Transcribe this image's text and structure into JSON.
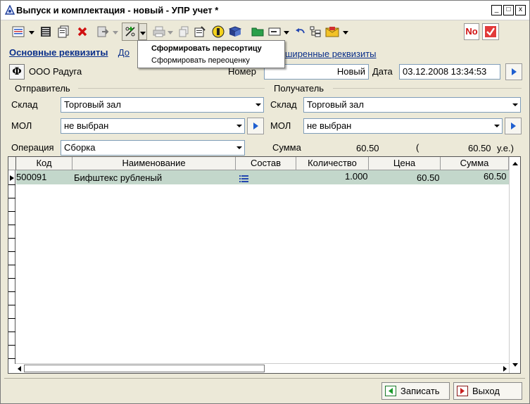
{
  "window": {
    "title": "Выпуск и комплектация  - новый - УПР учет *",
    "controls": {
      "minimize": "_",
      "maximize": "□",
      "close": "x"
    }
  },
  "toolbar": {
    "badge_no": "No",
    "icons": [
      "list-icon",
      "report-icon",
      "copy-icon",
      "delete-icon",
      "export-icon",
      "percent-icon",
      "print-icon",
      "copy-doc-icon",
      "properties-icon",
      "info-icon",
      "book-icon",
      "folder-icon",
      "card-icon",
      "undo-icon",
      "structure-icon",
      "mail-icon",
      "no-icon",
      "check-icon"
    ]
  },
  "popup_menu": {
    "items": [
      "Сформировать пересортицу",
      "Сформировать переоценку"
    ]
  },
  "tabs_links": {
    "main": "Основные реквизиты",
    "additional_partial": "До",
    "extended_partial": "ширенные реквизиты"
  },
  "header": {
    "org_button": "Ф",
    "org_name": "ООО Радуга",
    "number_label": "Номер",
    "number_status": "Новый",
    "date_label": "Дата",
    "date_value": "03.12.2008 13:34:53"
  },
  "sender": {
    "group_label": "Отправитель",
    "warehouse_label": "Склад",
    "warehouse_value": "Торговый зал",
    "mol_label": "МОЛ",
    "mol_value": "не выбран"
  },
  "receiver": {
    "group_label": "Получатель",
    "warehouse_label": "Склад",
    "warehouse_value": "Торговый зал",
    "mol_label": "МОЛ",
    "mol_value": "не выбран"
  },
  "operation": {
    "label": "Операция",
    "value": "Сборка",
    "sum_label": "Сумма",
    "sum_value": "60.50",
    "paren": "(",
    "sum_ue_value": "60.50",
    "sum_ue_unit": "у.е.)"
  },
  "table": {
    "columns": [
      "Код",
      "Наименование",
      "Состав",
      "Количество",
      "Цена",
      "Сумма"
    ],
    "rows": [
      {
        "code": "500091",
        "name": "Бифштекс рубленый",
        "qty": "1.000",
        "price": "60.50",
        "sum": "60.50"
      }
    ]
  },
  "footer": {
    "save_label": "Записать",
    "exit_label": "Выход"
  }
}
